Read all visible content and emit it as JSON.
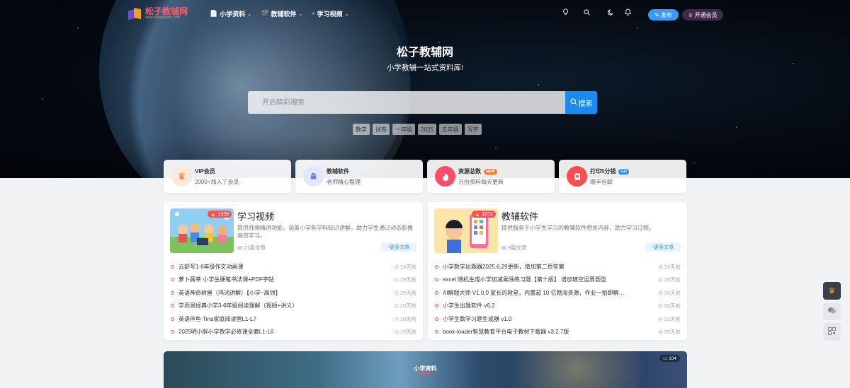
{
  "nav": {
    "logo_text": "松子教辅网",
    "logo_sub": "www.songzijiaofu.com",
    "menu": [
      {
        "icon": "📄",
        "label": "小学资料"
      },
      {
        "icon": "🎬",
        "label": "教辅软件"
      },
      {
        "icon": "●",
        "label": "学习视频"
      }
    ],
    "publish_label": "发布",
    "vip_label": "开通会员"
  },
  "hero": {
    "title": "松子教辅网",
    "subtitle": "小学教辅一站式资料库!",
    "search_placeholder": "开启精彩搜索",
    "search_button": "搜索",
    "tags": [
      "数学",
      "试卷",
      "一年级",
      "2025",
      "五年级",
      "写字"
    ]
  },
  "features": [
    {
      "title": "VIP会员",
      "desc": "2000+加入了会员",
      "badge": "",
      "icon": "crown-icon",
      "color": "#ff8a4a"
    },
    {
      "title": "教辅软件",
      "desc": "老师精心整理",
      "badge": "",
      "icon": "android-icon",
      "color": "#6a7fe8"
    },
    {
      "title": "资源总数",
      "desc": "万份资料每天更新",
      "badge": "NEW",
      "icon": "fire-icon",
      "color": "#ff4d6a"
    },
    {
      "title": "打印5分钱",
      "desc": "顺丰包邮",
      "badge": "GO",
      "icon": "printer-icon",
      "color": "#ff4d4d"
    }
  ],
  "cards": [
    {
      "title": "学习视频",
      "count": "1939",
      "desc": "提供视频精讲功能，涵盖小学各学科知识讲解，助力学生通过动态影像高效学习。",
      "meta": "21篇文章",
      "more": "更多文章",
      "posts": [
        {
          "title": "云舒写1-6年级作文动画课",
          "time": "13天前"
        },
        {
          "title": "萝卜薇莘 小学生硬笔书法课+PDF字帖",
          "time": "19天前"
        },
        {
          "title": "英语神奇树屋（鸿词讲解）【小学~高领】",
          "time": "19天前"
        },
        {
          "title": "学而思经典小学3-6年级阅读理解（视频+讲义）",
          "time": "19天前"
        },
        {
          "title": "英语伴鱼 Tina家庭阅读营L1-L7",
          "time": "19天前"
        },
        {
          "title": "2025明小胖小学数学必修课全套L1-L6",
          "time": "19天前"
        }
      ]
    },
    {
      "title": "教辅软件",
      "count": "1672",
      "desc": "提供服务于小学生学习的教辅软件相关内容，助力学习过程。",
      "meta": "9篇文章",
      "more": "更多文章",
      "posts": [
        {
          "title": "小学数学出题器2025.6.29更新，增加第二页答案",
          "time": "15天前"
        },
        {
          "title": "excel 随机生成小学加减乘除练习题【第十版】 增加填空运算题型",
          "time": "20天前"
        },
        {
          "title": "AI解题大师 V1.0.0 家长的救星，内置超 10 亿题海资源，作业一拍即解…",
          "time": "26天前"
        },
        {
          "title": "小学生出题软件 v6.2",
          "time": "33天前"
        },
        {
          "title": "小学生数学习题生成器 v1.0",
          "time": "33天前"
        },
        {
          "title": "book-loader智慧教育平台电子教材下载器 v3.2.7版",
          "time": "35天前"
        }
      ]
    }
  ],
  "banner": {
    "title": "小学资料",
    "count": "104"
  }
}
